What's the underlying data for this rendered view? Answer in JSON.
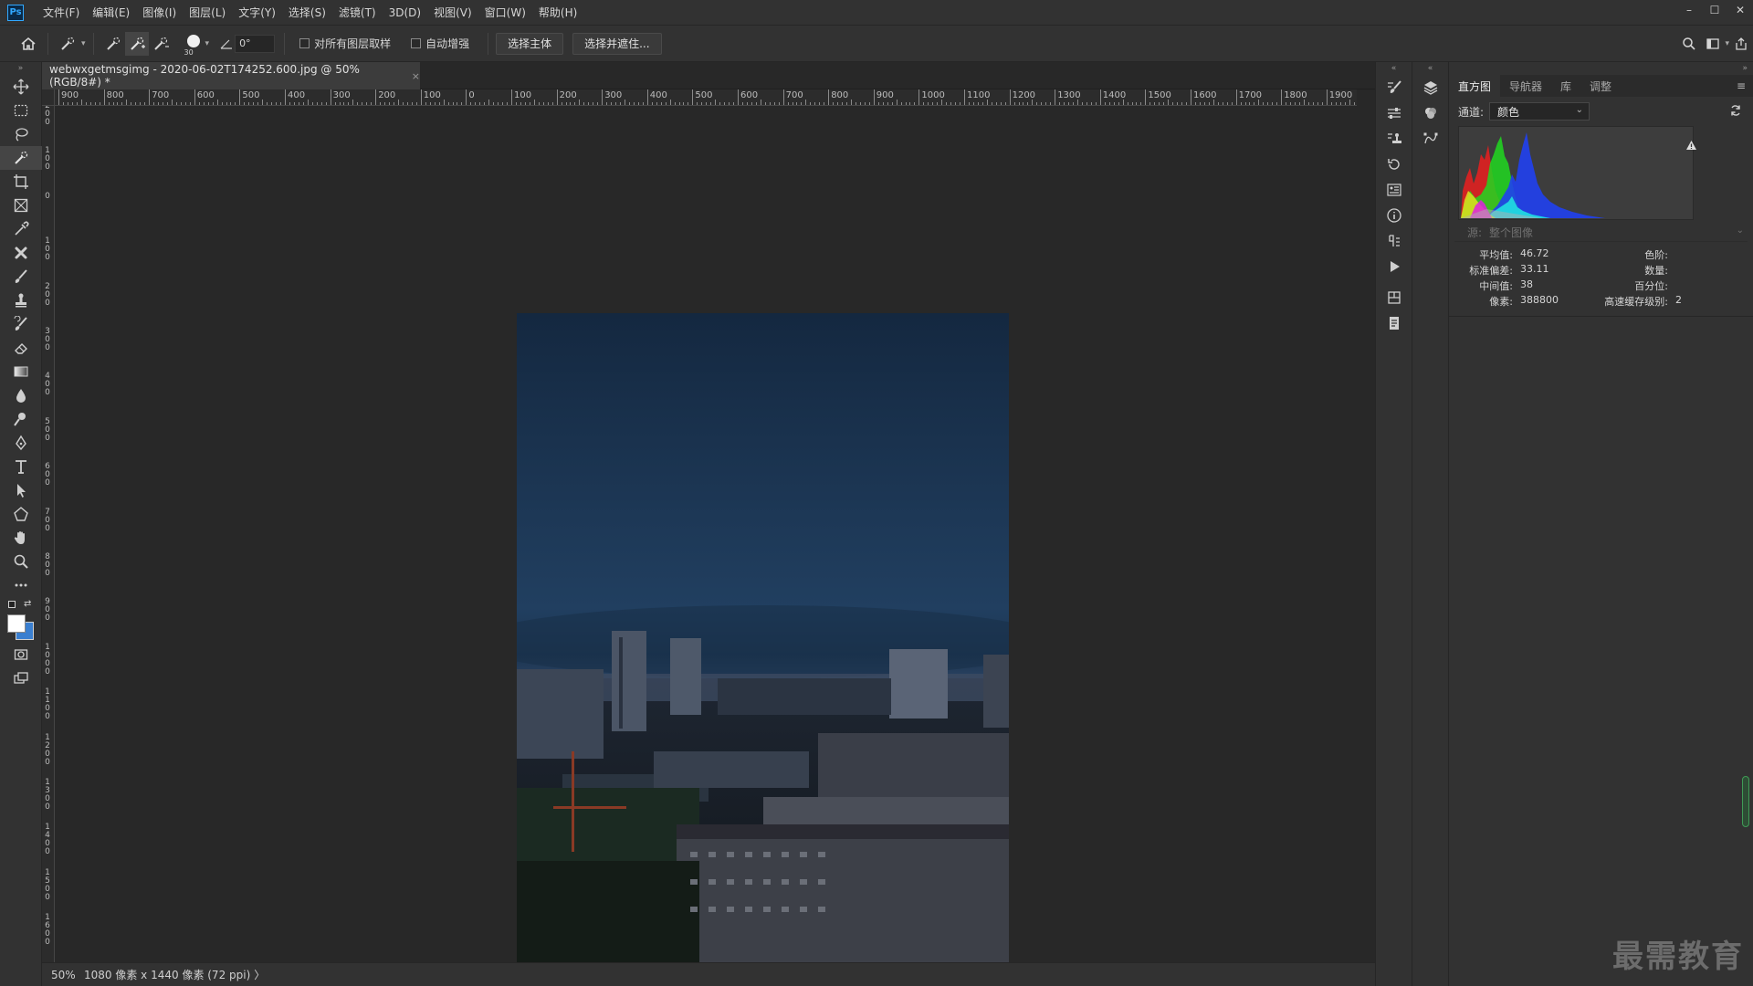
{
  "app": {
    "logo_text": "Ps"
  },
  "menubar": {
    "items": [
      "文件(F)",
      "编辑(E)",
      "图像(I)",
      "图层(L)",
      "文字(Y)",
      "选择(S)",
      "滤镜(T)",
      "3D(D)",
      "视图(V)",
      "窗口(W)",
      "帮助(H)"
    ],
    "window_controls": [
      "–",
      "☐",
      "✕"
    ]
  },
  "options": {
    "brush_size": "30",
    "angle_value": "0°",
    "sample_all_layers": "对所有图层取样",
    "auto_enhance": "自动增强",
    "select_subject": "选择主体",
    "select_and_mask": "选择并遮住..."
  },
  "document": {
    "tab_title": "webwxgetmsgimg - 2020-06-02T174252.600.jpg @ 50%(RGB/8#) *",
    "close": "×"
  },
  "ruler": {
    "h_labels": [
      "900",
      "800",
      "700",
      "600",
      "500",
      "400",
      "300",
      "200",
      "100",
      "0",
      "100",
      "200",
      "300",
      "400",
      "500",
      "600",
      "700",
      "800",
      "900",
      "1000",
      "1100",
      "1200",
      "1300",
      "1400",
      "1500",
      "1600",
      "1700",
      "1800",
      "1900"
    ],
    "v_labels": [
      "200",
      "100",
      "0",
      "100",
      "200",
      "300",
      "400",
      "500",
      "600",
      "700",
      "800",
      "900",
      "1000",
      "1100",
      "1200",
      "1300",
      "1400",
      "1500",
      "1600"
    ]
  },
  "status": {
    "zoom": "50%",
    "info": "1080 像素 x 1440 像素 (72 ppi)",
    "arrow": "〉"
  },
  "panel": {
    "tabs": [
      "直方图",
      "导航器",
      "库",
      "调整"
    ],
    "active_tab": "直方图",
    "menu_icon": "≡",
    "channel_label": "通道:",
    "channel_value": "颜色",
    "source_label": "源:",
    "source_value": "整个图像",
    "stats": {
      "mean_label": "平均值:",
      "mean_value": "46.72",
      "std_label": "标准偏差:",
      "std_value": "33.11",
      "median_label": "中间值:",
      "median_value": "38",
      "pixels_label": "像素:",
      "pixels_value": "388800",
      "level_label": "色阶:",
      "level_value": "",
      "count_label": "数量:",
      "count_value": "",
      "percentile_label": "百分位:",
      "percentile_value": "",
      "cache_label": "高速缓存级别:",
      "cache_value": "2"
    }
  },
  "watermark": "最需教育",
  "colors": {
    "accent": "#31a8ff",
    "panel_bg": "#323232",
    "canvas_bg": "#282828"
  }
}
